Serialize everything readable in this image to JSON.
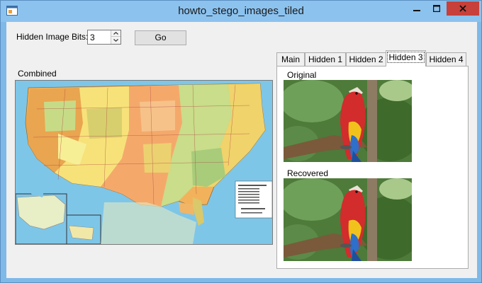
{
  "window": {
    "title": "howto_stego_images_tiled"
  },
  "controls": {
    "bits_label": "Hidden Image Bits:",
    "bits_value": "3",
    "go_label": "Go",
    "combined_label": "Combined"
  },
  "tabs": [
    {
      "label": "Main"
    },
    {
      "label": "Hidden 1"
    },
    {
      "label": "Hidden 2"
    },
    {
      "label": "Hidden 3"
    },
    {
      "label": "Hidden 4"
    }
  ],
  "active_tab": "Hidden 3",
  "panel": {
    "original_label": "Original",
    "recovered_label": "Recovered"
  },
  "colors": {
    "titlebar": "#8cc2ee",
    "close_button": "#c7403a",
    "client": "#f0f0f0"
  },
  "icons": {
    "app": "app-icon",
    "minimize": "minimize-icon",
    "maximize": "maximize-icon",
    "close": "close-icon",
    "spin_up": "chevron-up-icon",
    "spin_down": "chevron-down-icon"
  }
}
